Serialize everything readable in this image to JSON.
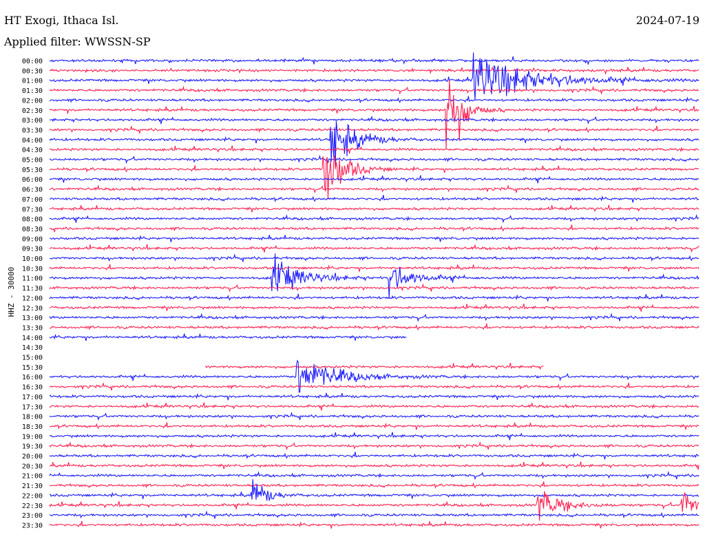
{
  "header": {
    "station": "HT Exogi, Ithaca Isl.",
    "filter": "Applied filter: WWSSN-SP",
    "date": "2024-07-19"
  },
  "channel_label": "HHZ - 30000",
  "colors": {
    "blue": "#1a1aff",
    "red": "#ff2050"
  },
  "chart_data": {
    "type": "line",
    "title": "HT Exogi, Ithaca Isl.",
    "subtitle": "Applied filter: WWSSN-SP",
    "date": "2024-07-19",
    "ylabel": "HHZ - 30000",
    "ytick_labels": [
      "00:00",
      "00:30",
      "01:00",
      "01:30",
      "02:00",
      "02:30",
      "03:00",
      "03:30",
      "04:00",
      "04:30",
      "05:00",
      "05:30",
      "06:00",
      "06:30",
      "07:00",
      "07:30",
      "08:00",
      "08:30",
      "09:00",
      "09:30",
      "10:00",
      "10:30",
      "11:00",
      "11:30",
      "12:00",
      "12:30",
      "13:00",
      "13:30",
      "14:00",
      "14:30",
      "15:00",
      "15:30",
      "16:00",
      "16:30",
      "17:00",
      "17:30",
      "18:00",
      "18:30",
      "19:00",
      "19:30",
      "20:00",
      "20:30",
      "21:00",
      "21:30",
      "22:00",
      "22:30",
      "23:00",
      "23:30"
    ],
    "line_colors": [
      "blue",
      "red"
    ],
    "line_extent": [
      1,
      1,
      1,
      1,
      1,
      1,
      1,
      1,
      1,
      1,
      1,
      1,
      1,
      1,
      1,
      1,
      1,
      1,
      1,
      1,
      1,
      1,
      1,
      1,
      1,
      1,
      1,
      1,
      0.55,
      0,
      0,
      0.76,
      1,
      1,
      1,
      1,
      1,
      1,
      1,
      1,
      1,
      1,
      1,
      1,
      1,
      1,
      1,
      1
    ],
    "line_start": [
      0,
      0,
      0,
      0,
      0,
      0,
      0,
      0,
      0,
      0,
      0,
      0,
      0,
      0,
      0,
      0,
      0,
      0,
      0,
      0,
      0,
      0,
      0,
      0,
      0,
      0,
      0,
      0,
      0,
      0,
      0,
      0.24,
      0,
      0,
      0,
      0,
      0,
      0,
      0,
      0,
      0,
      0,
      0,
      0,
      0,
      0,
      0,
      0
    ],
    "events": [
      {
        "t": 0.65,
        "line": 2,
        "amp": 40,
        "dur": 0.12
      },
      {
        "t": 0.43,
        "line": 8,
        "amp": 45,
        "dur": 0.05
      },
      {
        "t": 0.61,
        "line": 5,
        "amp": 90,
        "dur": 0.03
      },
      {
        "t": 0.42,
        "line": 11,
        "amp": 60,
        "dur": 0.04
      },
      {
        "t": 0.34,
        "line": 22,
        "amp": 30,
        "dur": 0.06
      },
      {
        "t": 0.52,
        "line": 22,
        "amp": 25,
        "dur": 0.05
      },
      {
        "t": 0.8,
        "line": 31,
        "amp": 30,
        "dur": 0.06
      },
      {
        "t": 0.38,
        "line": 32,
        "amp": 30,
        "dur": 0.08
      },
      {
        "t": 0.31,
        "line": 44,
        "amp": 28,
        "dur": 0.03
      },
      {
        "t": 0.75,
        "line": 45,
        "amp": 25,
        "dur": 0.05
      },
      {
        "t": 0.97,
        "line": 45,
        "amp": 30,
        "dur": 0.03
      }
    ]
  }
}
